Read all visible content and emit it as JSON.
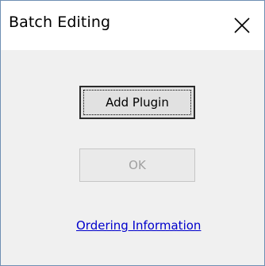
{
  "window": {
    "title": "Batch Editing"
  },
  "buttons": {
    "add_plugin": "Add Plugin",
    "ok": "OK"
  },
  "links": {
    "ordering_information": "Ordering Information"
  },
  "icons": {
    "close": "close-icon"
  },
  "colors": {
    "link": "#0000cc",
    "dialog_background": "#f0f0f0",
    "disabled_text": "#a0a0a0"
  },
  "state": {
    "ok_enabled": false,
    "focused_button": "Add Plugin"
  }
}
